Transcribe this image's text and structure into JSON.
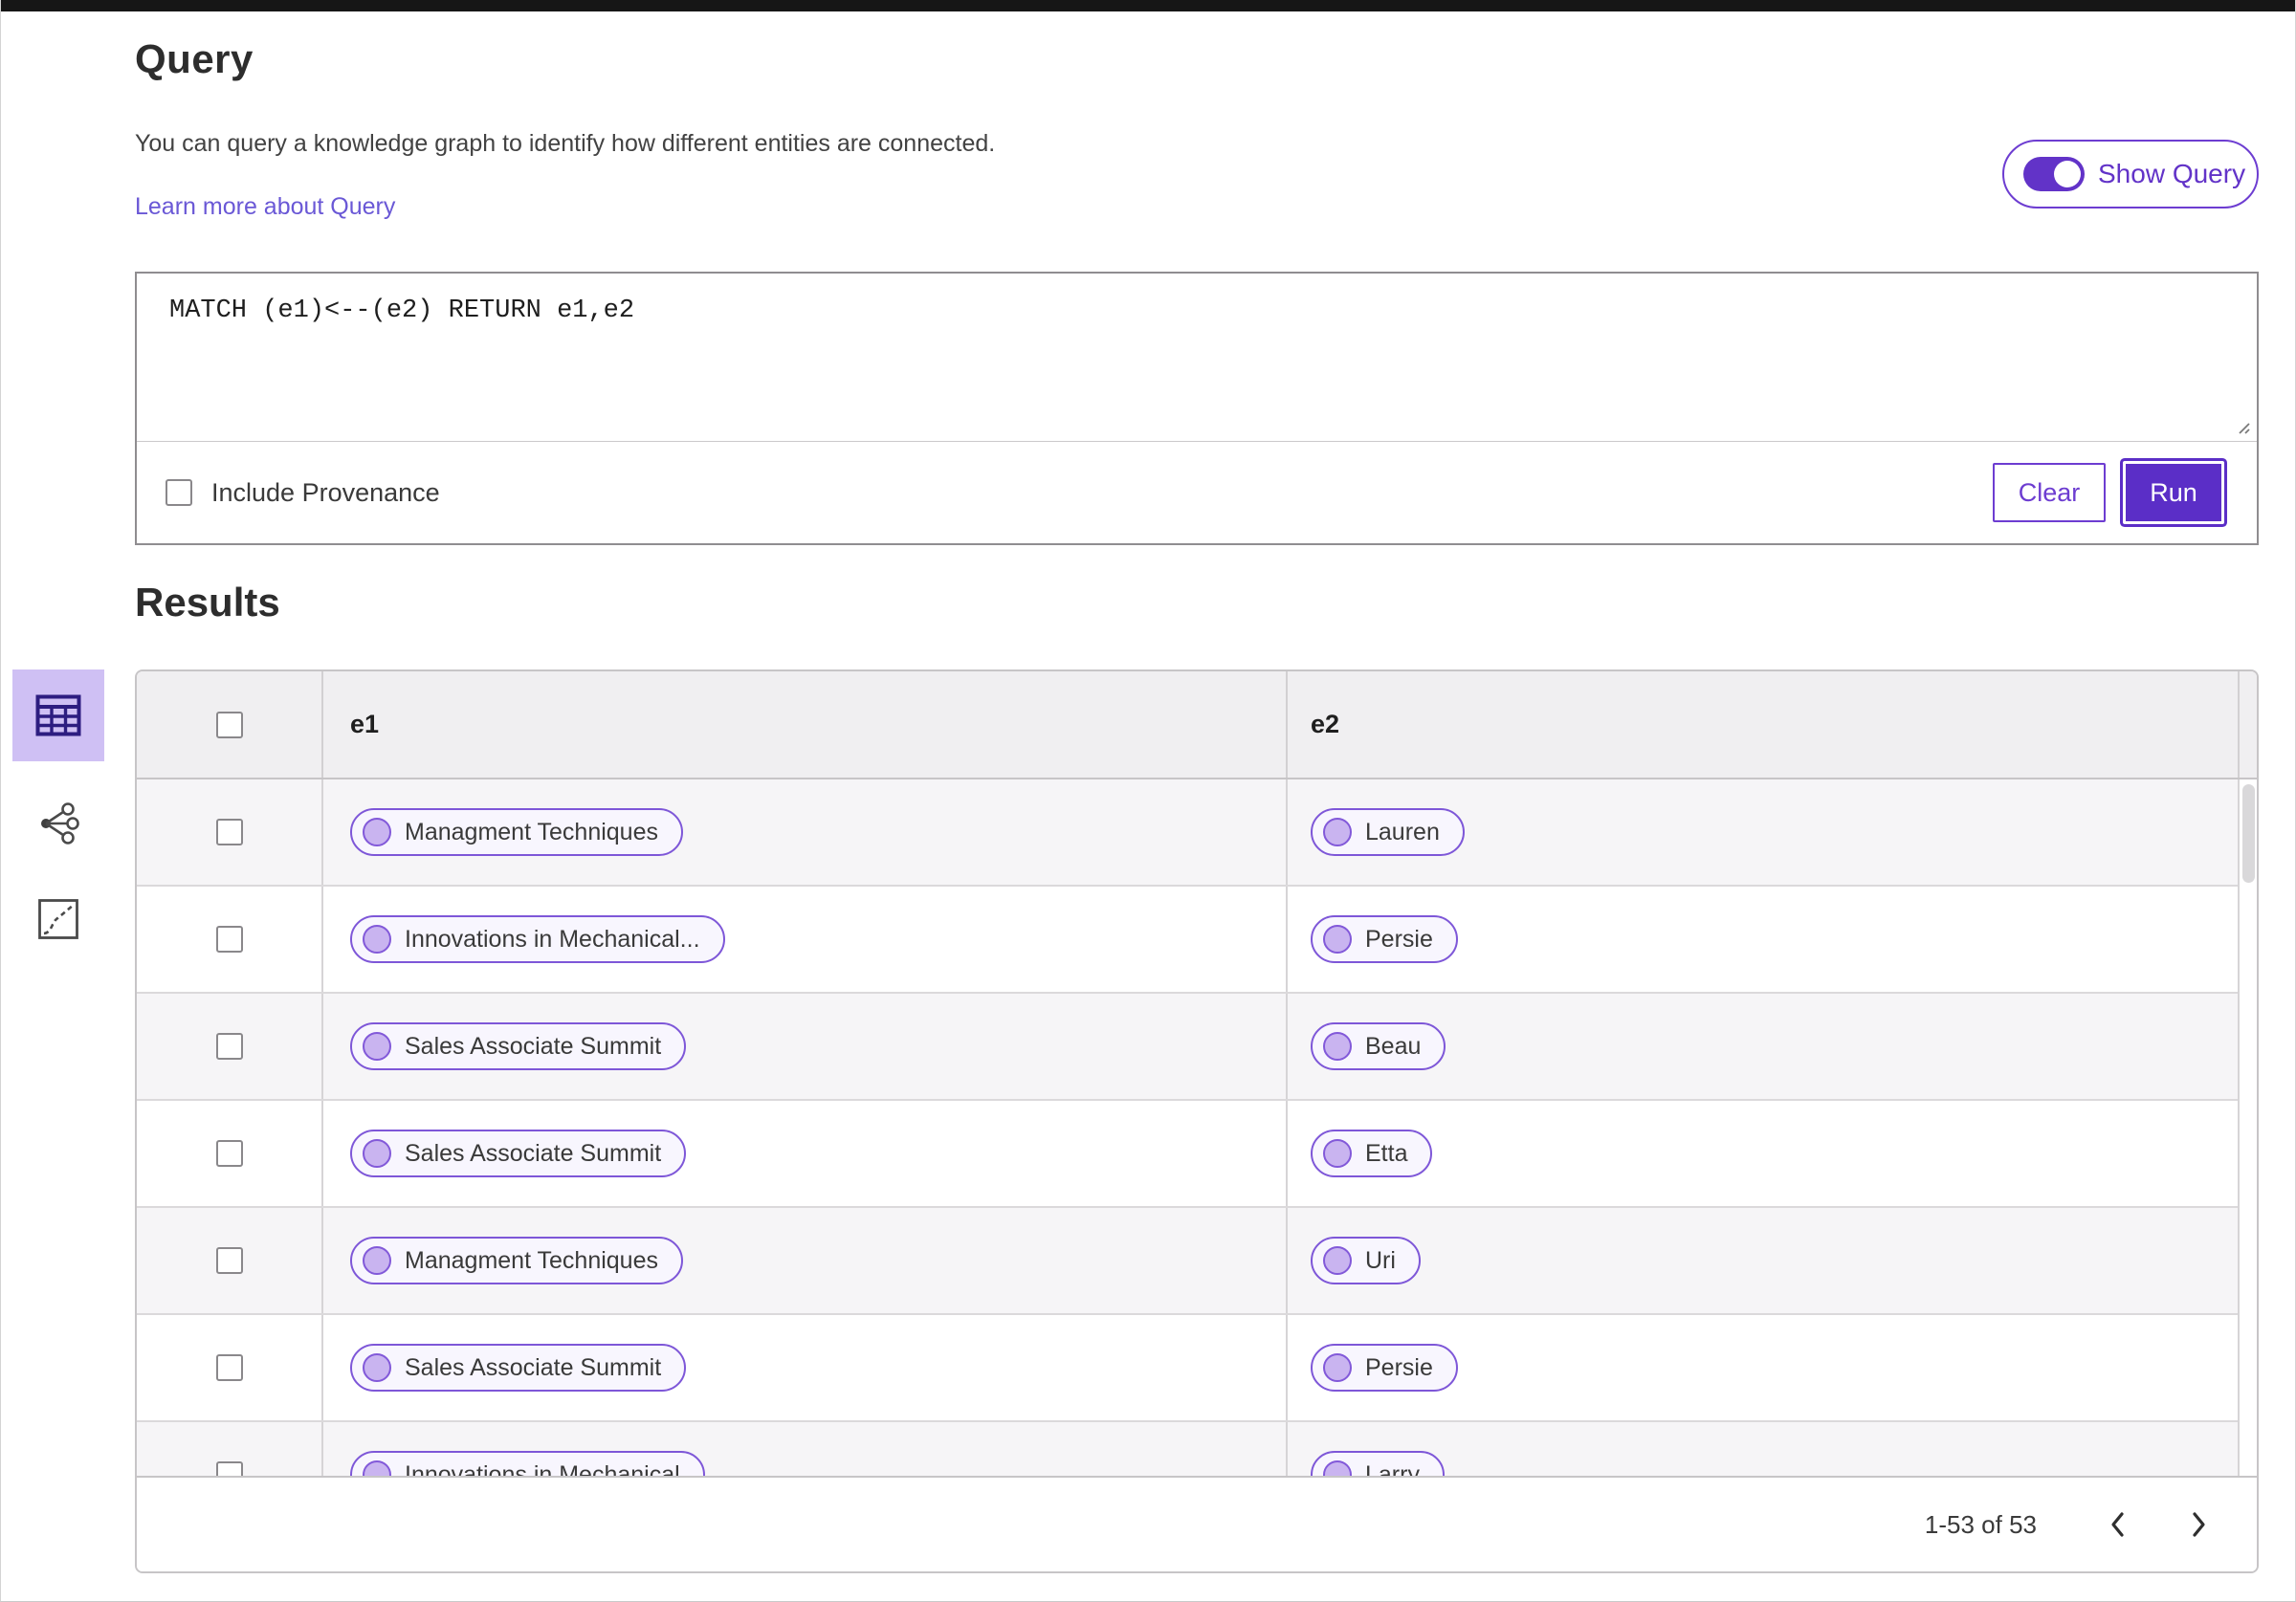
{
  "query": {
    "title": "Query",
    "description": "You can query a knowledge graph to identify how different entities are connected.",
    "learn_more_label": "Learn more about Query",
    "show_query_label": "Show Query",
    "show_query_on": true,
    "query_text": "MATCH (e1)<--(e2) RETURN e1,e2",
    "include_provenance_label": "Include Provenance",
    "include_provenance_checked": false,
    "clear_label": "Clear",
    "run_label": "Run"
  },
  "results": {
    "title": "Results",
    "columns": [
      "e1",
      "e2"
    ],
    "rows": [
      {
        "e1": "Managment Techniques",
        "e2": "Lauren"
      },
      {
        "e1": "Innovations in Mechanical...",
        "e2": "Persie"
      },
      {
        "e1": "Sales Associate Summit",
        "e2": "Beau"
      },
      {
        "e1": "Sales Associate Summit",
        "e2": "Etta"
      },
      {
        "e1": "Managment Techniques",
        "e2": "Uri"
      },
      {
        "e1": "Sales Associate Summit",
        "e2": "Persie"
      },
      {
        "e1": "Innovations in Mechanical",
        "e2": "Larry"
      }
    ],
    "pagination": {
      "range_label": "1-53 of 53"
    }
  },
  "view_rail": {
    "items": [
      {
        "name": "table-view",
        "icon": "table-icon",
        "selected": true
      },
      {
        "name": "graph-view",
        "icon": "graph-network-icon",
        "selected": false
      },
      {
        "name": "chart-view",
        "icon": "chart-box-icon",
        "selected": false
      }
    ]
  },
  "colors": {
    "accent_purple": "#6233c8",
    "run_button": "#5b2ec7",
    "button_border": "#6d3dd1",
    "link": "#6a58d6",
    "pill_border": "#7e57d8",
    "pill_background": "#f8f6fe",
    "pill_dot_fill": "#c9b4f0",
    "pill_dot_border": "#8259d9",
    "rail_selected_background": "#cfc0f4",
    "rail_selected_icon": "#2d1d80",
    "table_header_background": "#f0eff1",
    "row_alt_background": "#f6f5f7",
    "table_border": "#c7c5c7",
    "topbar": "#161616"
  }
}
